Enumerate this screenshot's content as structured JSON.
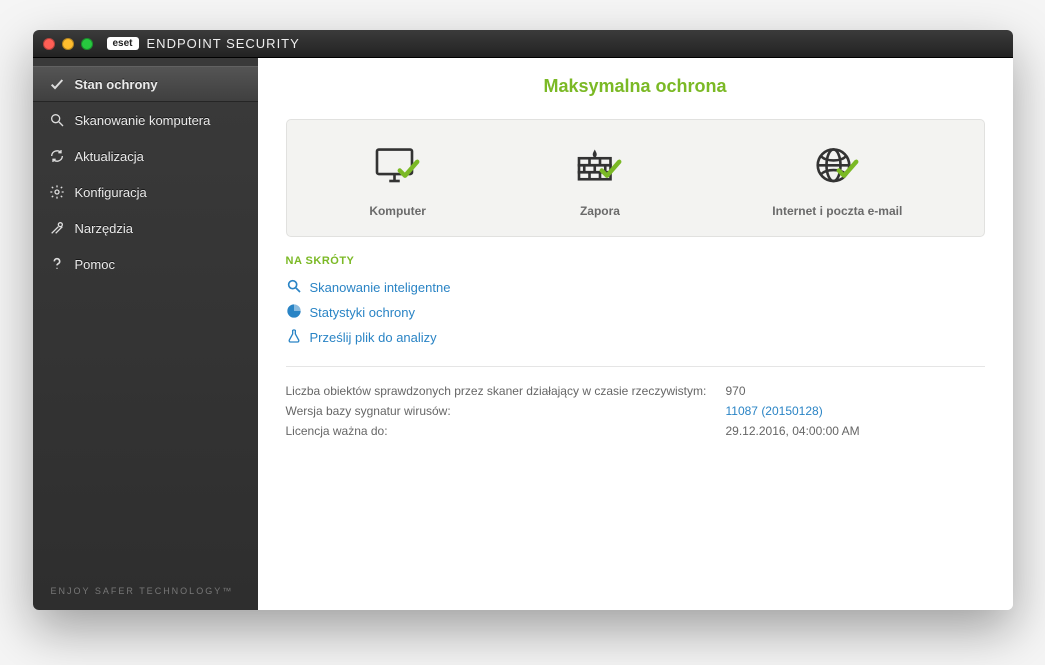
{
  "brand": {
    "logo_text": "eset",
    "title": "ENDPOINT SECURITY"
  },
  "sidebar": {
    "items": [
      {
        "label": "Stan ochrony"
      },
      {
        "label": "Skanowanie komputera"
      },
      {
        "label": "Aktualizacja"
      },
      {
        "label": "Konfiguracja"
      },
      {
        "label": "Narzędzia"
      },
      {
        "label": "Pomoc"
      }
    ],
    "footer": "ENJOY SAFER TECHNOLOGY™"
  },
  "main": {
    "title": "Maksymalna ochrona",
    "status": [
      {
        "label": "Komputer"
      },
      {
        "label": "Zapora"
      },
      {
        "label": "Internet i poczta e-mail"
      }
    ],
    "shortcuts_header": "NA SKRÓTY",
    "shortcuts": [
      {
        "label": "Skanowanie inteligentne"
      },
      {
        "label": "Statystyki ochrony"
      },
      {
        "label": "Prześlij plik do analizy"
      }
    ],
    "info": [
      {
        "label": "Liczba obiektów sprawdzonych przez skaner działający w czasie rzeczywistym:",
        "value": "970",
        "link": false
      },
      {
        "label": "Wersja bazy sygnatur wirusów:",
        "value": "11087 (20150128)",
        "link": true
      },
      {
        "label": "Licencja ważna do:",
        "value": "29.12.2016, 04:00:00 AM",
        "link": false
      }
    ]
  }
}
